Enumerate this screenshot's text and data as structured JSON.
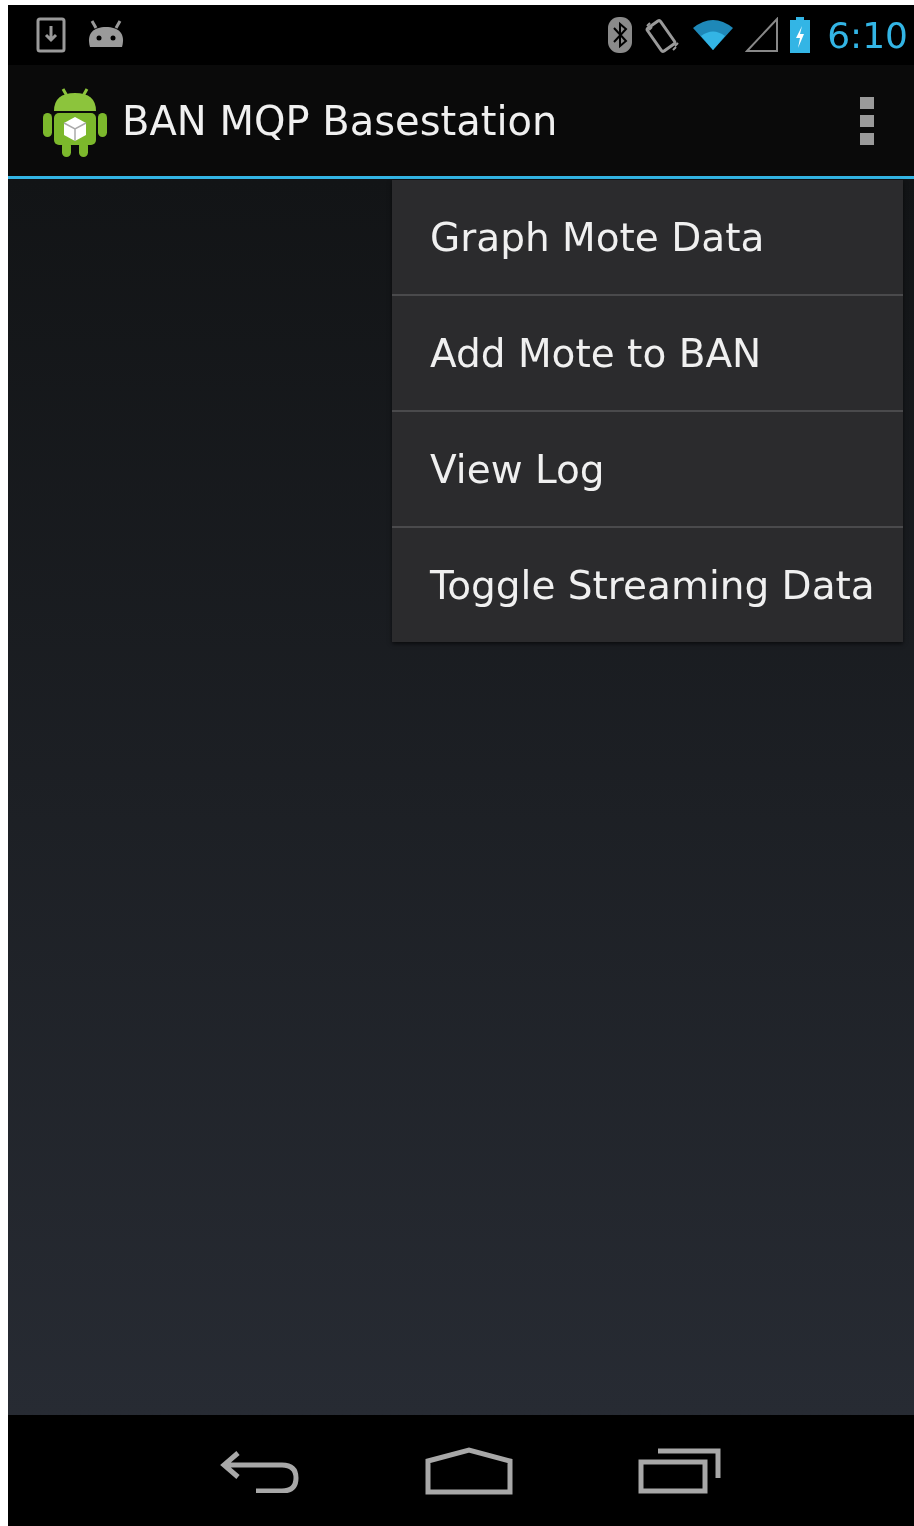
{
  "status_bar": {
    "time": "6:10"
  },
  "action_bar": {
    "title": "BAN MQP Basestation"
  },
  "overflow_menu": {
    "items": [
      {
        "label": "Graph Mote Data"
      },
      {
        "label": "Add Mote to BAN"
      },
      {
        "label": "View Log"
      },
      {
        "label": "Toggle Streaming Data"
      }
    ]
  }
}
